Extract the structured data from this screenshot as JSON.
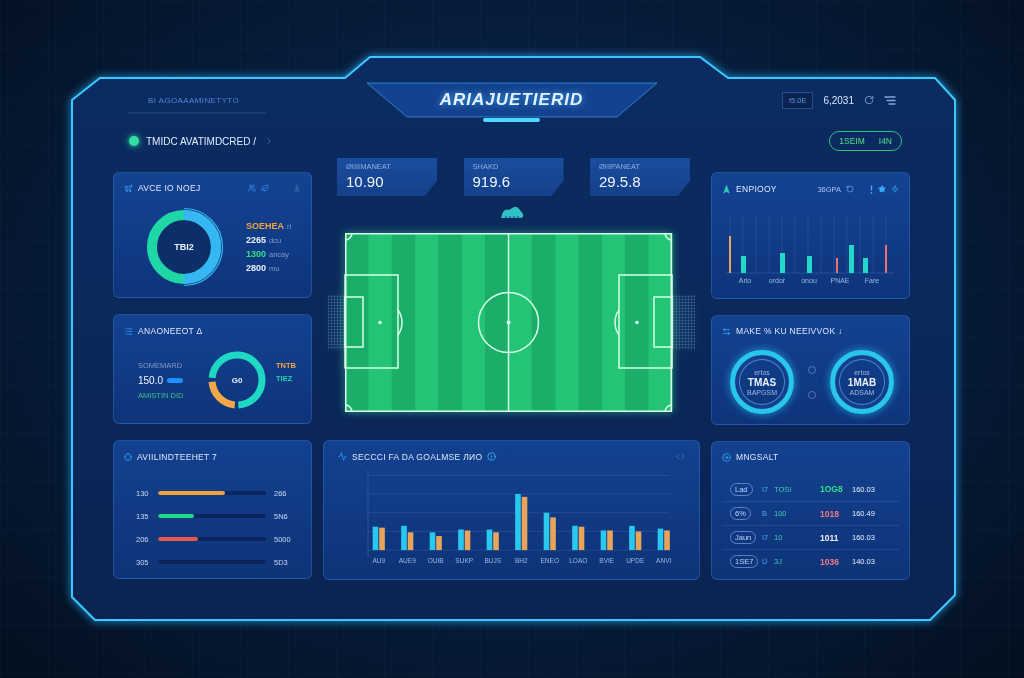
{
  "header": {
    "subtitle": "BI AGOAAAMINETYTO",
    "title": "ARIAJUETIERID",
    "range": "t5.0E",
    "reading": "6,2031"
  },
  "status": {
    "label": "TMIDC AVATIMDCRED /",
    "online": true,
    "pill": [
      "1SEIM",
      "I4N"
    ]
  },
  "summary_panel": {
    "title": "AVCE IO NOEJ",
    "center": "TBI2",
    "items": [
      {
        "value": "SOEHEA",
        "unit": "ri",
        "color": "#f0a23c"
      },
      {
        "value": "2265",
        "unit": "dcu",
        "color": "#e8f0ff"
      },
      {
        "value": "1300",
        "unit": "ancay",
        "color": "#2fe08a"
      },
      {
        "value": "2800",
        "unit": "mu",
        "color": "#e8f0ff"
      }
    ]
  },
  "stats": [
    {
      "label": "ØIIIIMANEAT",
      "value": "10.90"
    },
    {
      "label": "SHAKD",
      "value": "919.6"
    },
    {
      "label": "ØIIIPANEAT",
      "value": "29.5.8"
    }
  ],
  "bars_panel": {
    "title": "ENPIOOY",
    "subtitle": "36GPA",
    "axis_labels": [
      "Arlo",
      "ordor",
      "onou",
      "PNAE",
      "Fare"
    ]
  },
  "split_panel": {
    "title": "ANAONEEOT Δ",
    "caption": "SOMEMARD",
    "figure": "150.0",
    "note": "AMISTIN DID",
    "center": "G0",
    "legend": [
      {
        "label": "TNTB",
        "color": "#f0a23c"
      },
      {
        "label": "TIEZ",
        "color": "#22d3b0"
      }
    ]
  },
  "gauges_panel": {
    "title": "MAKE % KU NEEIVVOK ↓",
    "gauges": [
      {
        "caption": "ertos",
        "value": "TMAS",
        "sub": "BAPGSM"
      },
      {
        "caption": "ertos",
        "value": "1MAB",
        "sub": "ADSAM"
      }
    ]
  },
  "progress_panel": {
    "title": "AVIILINDTEEHET 7",
    "rows": [
      {
        "label": "130",
        "level": 0.62,
        "color": "#f0a23c",
        "value": "266"
      },
      {
        "label": "135",
        "level": 0.33,
        "color": "#22d98a",
        "value": "5N6"
      },
      {
        "label": "206",
        "level": 0.37,
        "color": "#e8584a",
        "value": "5000"
      },
      {
        "label": "305",
        "value": "5D3"
      }
    ]
  },
  "chart_panel": {
    "title": "SECCCI FA DA GOALMSE ЛИО",
    "axis_labels": [
      "AU9",
      "AUE9",
      "OUIB",
      "SUKP",
      "BUJS",
      "BH2",
      "ENEO",
      "LOAO",
      "BVIE",
      "UPDE",
      "ANVI"
    ]
  },
  "table_panel": {
    "title": "MNGSALT",
    "rows": [
      {
        "tag": "Lad",
        "code": "I7",
        "name": "TOSI",
        "delta": "1OG8",
        "color": "#2fe08a",
        "value": "160.03"
      },
      {
        "tag": "6%",
        "code": "B",
        "name": "100",
        "delta": "1018",
        "color": "#f07a8a",
        "value": "160.49"
      },
      {
        "tag": "Jaun",
        "code": "I7",
        "name": "10",
        "delta": "1011",
        "color": "#e8f0ff",
        "value": "160.03"
      },
      {
        "tag": "1SE7",
        "code": "Ü",
        "name": "3J",
        "delta": "1036",
        "color": "#f07a8a",
        "value": "140.03"
      }
    ]
  }
}
